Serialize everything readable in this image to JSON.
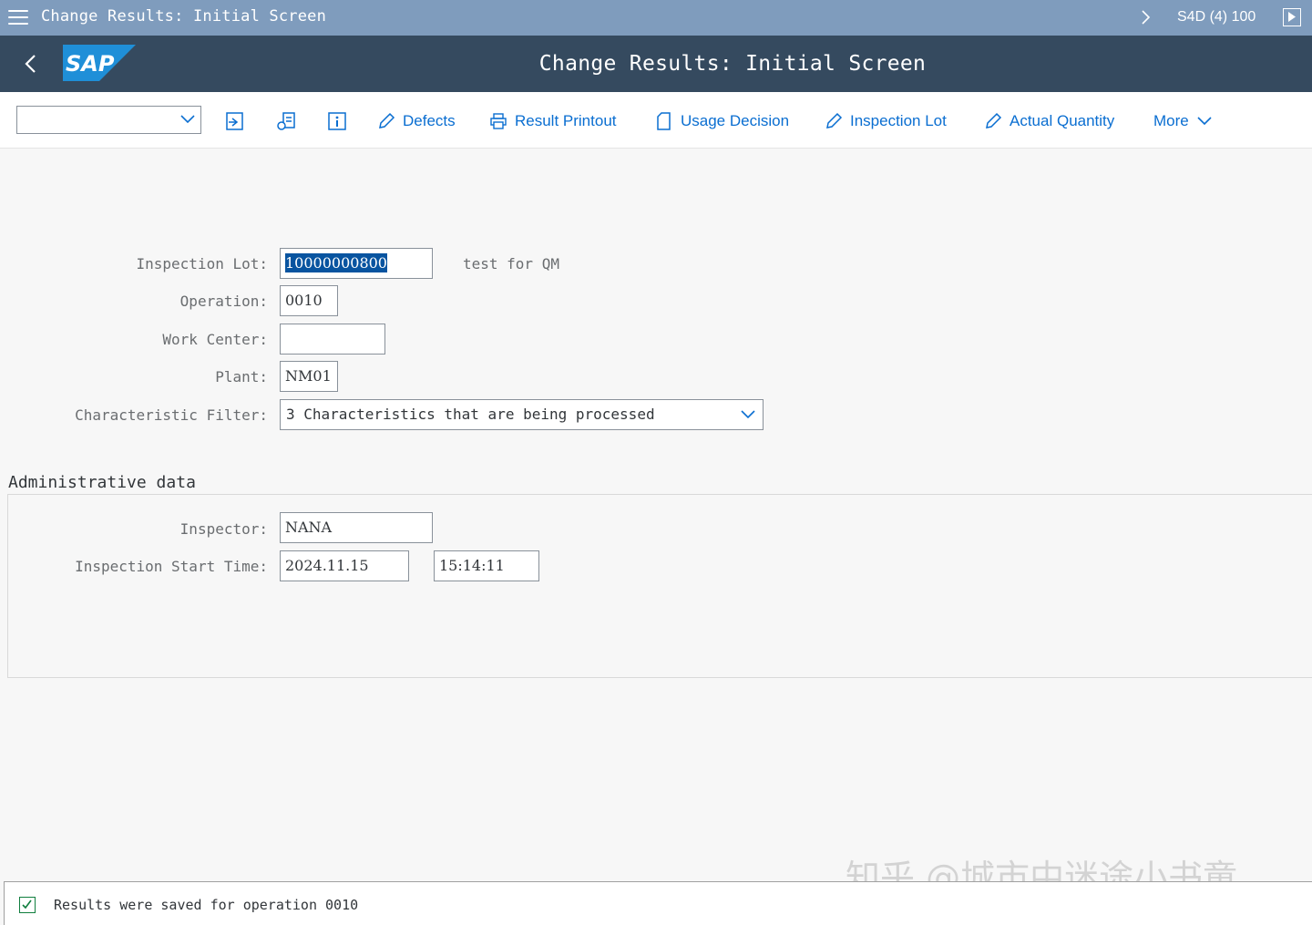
{
  "window": {
    "title": "Change Results: Initial Screen",
    "system": "S4D (4) 100"
  },
  "shell": {
    "title": "Change Results: Initial Screen",
    "logo_text": "SAP"
  },
  "toolbar": {
    "select_value": "",
    "buttons": {
      "defects": "Defects",
      "result_printout": "Result Printout",
      "usage_decision": "Usage Decision",
      "inspection_lot": "Inspection Lot",
      "actual_quantity": "Actual Quantity",
      "more": "More"
    }
  },
  "form": {
    "inspection_lot": {
      "label": "Inspection Lot:",
      "value": "10000000800",
      "description": "test for QM"
    },
    "operation": {
      "label": "Operation:",
      "value": "0010"
    },
    "work_center": {
      "label": "Work Center:",
      "value": ""
    },
    "plant": {
      "label": "Plant:",
      "value": "NM01"
    },
    "characteristic_filter": {
      "label": "Characteristic Filter:",
      "value": "3 Characteristics that are being processed"
    }
  },
  "admin": {
    "title": "Administrative data",
    "inspector": {
      "label": "Inspector:",
      "value": "NANA"
    },
    "start_time": {
      "label": "Inspection Start Time:",
      "date": "2024.11.15",
      "time": "15:14:11"
    }
  },
  "status": {
    "message": "Results were saved for operation 0010"
  },
  "watermark": "知乎 @城市中迷途小书童",
  "colors": {
    "window_bar": "#7f9cbd",
    "shell_bar": "#354a5f",
    "link_blue": "#0a6ed1",
    "logo_blue": "#1f8fd8",
    "success_green": "#107e3e"
  }
}
